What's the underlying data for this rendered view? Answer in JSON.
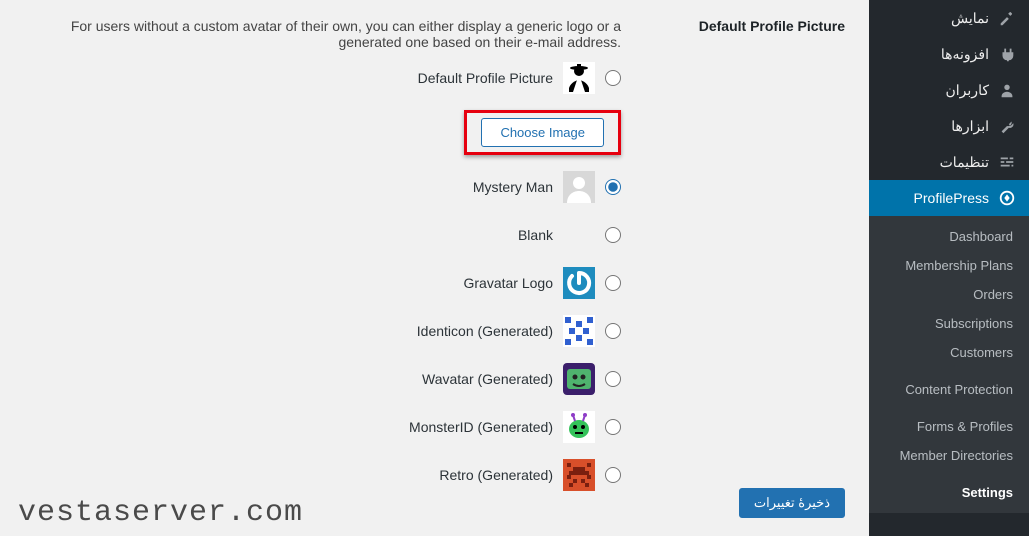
{
  "sidebar": {
    "items": [
      {
        "label": "نمایش"
      },
      {
        "label": "افزونه‌ها"
      },
      {
        "label": "کاربران"
      },
      {
        "label": "ابزارها"
      },
      {
        "label": "تنظیمات"
      },
      {
        "label": "ProfilePress"
      }
    ]
  },
  "submenu": {
    "dashboard": "Dashboard",
    "membership_plans": "Membership Plans",
    "orders": "Orders",
    "subscriptions": "Subscriptions",
    "customers": "Customers",
    "content_protection": "Content Protection",
    "forms_profiles": "Forms & Profiles",
    "member_directories": "Member Directories",
    "settings": "Settings"
  },
  "section": {
    "title": "Default Profile Picture",
    "help": "For users without a custom avatar of their own, you can either display a generic logo or a generated one based on their e-mail address."
  },
  "options": {
    "default_profile_picture": "Default Profile Picture",
    "choose_image": "Choose Image",
    "mystery_man": "Mystery Man",
    "blank": "Blank",
    "gravatar_logo": "Gravatar Logo",
    "identicon": "Identicon (Generated)",
    "wavatar": "Wavatar (Generated)",
    "monsterid": "MonsterID (Generated)",
    "retro": "Retro (Generated)"
  },
  "buttons": {
    "save": "ذخیرهٔ تغییرات"
  },
  "watermark": "vestaserver.com"
}
